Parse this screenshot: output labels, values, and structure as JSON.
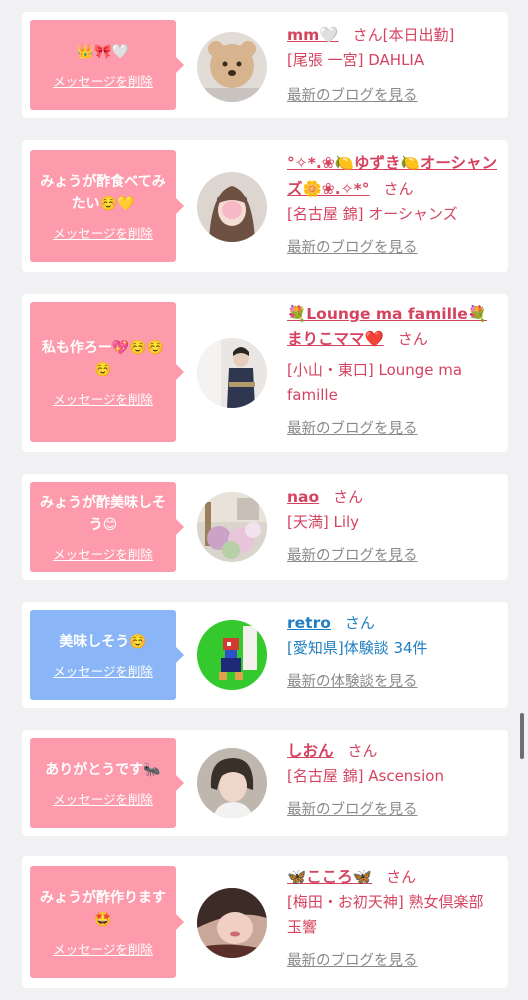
{
  "entries": [
    {
      "message": "👑🎀🤍",
      "delete_label": "メッセージを削除",
      "name": "mm🤍",
      "san": "さん",
      "status": "[本日出勤]",
      "shop": "[尾張 一宮] DAHLIA",
      "link": "最新のブログを見る",
      "theme": "pink"
    },
    {
      "message": "みょうが酢食べてみたい☺️💛",
      "delete_label": "メッセージを削除",
      "name": "°✧*.❀🍋ゆずき🍋オーシャンズ🌼❀.✧*°",
      "san": "さん",
      "shop": "[名古屋 錦] オーシャンズ",
      "link": "最新のブログを見る",
      "theme": "pink"
    },
    {
      "message": "私も作ろー💖☺️☺️☺️",
      "delete_label": "メッセージを削除",
      "name": "💐Lounge ma famille💐まりこママ❤️",
      "san": "さん",
      "shop": "[小山・東口] Lounge ma famille",
      "link": "最新のブログを見る",
      "theme": "pink"
    },
    {
      "message": "みょうが酢美味しそう😊",
      "delete_label": "メッセージを削除",
      "name": "nao",
      "san": "さん",
      "shop": "[天満] Lily",
      "link": "最新のブログを見る",
      "theme": "pink"
    },
    {
      "message": "美味しそう☺️",
      "delete_label": "メッセージを削除",
      "name": "retro",
      "san": "さん",
      "shop": "[愛知県]体験談 34件",
      "link": "最新の体験談を見る",
      "theme": "blue"
    },
    {
      "message": "ありがとうです🐜",
      "delete_label": "メッセージを削除",
      "name": "しおん",
      "san": "さん",
      "shop": "[名古屋 錦] Ascension",
      "link": "最新のブログを見る",
      "theme": "pink"
    },
    {
      "message": "みょうが酢作ります🤩",
      "delete_label": "メッセージを削除",
      "name": "🦋こころ🦋",
      "san": "さん",
      "shop": "[梅田・お初天神] 熟女倶楽部 玉響",
      "link": "最新のブログを見る",
      "theme": "pink"
    }
  ]
}
